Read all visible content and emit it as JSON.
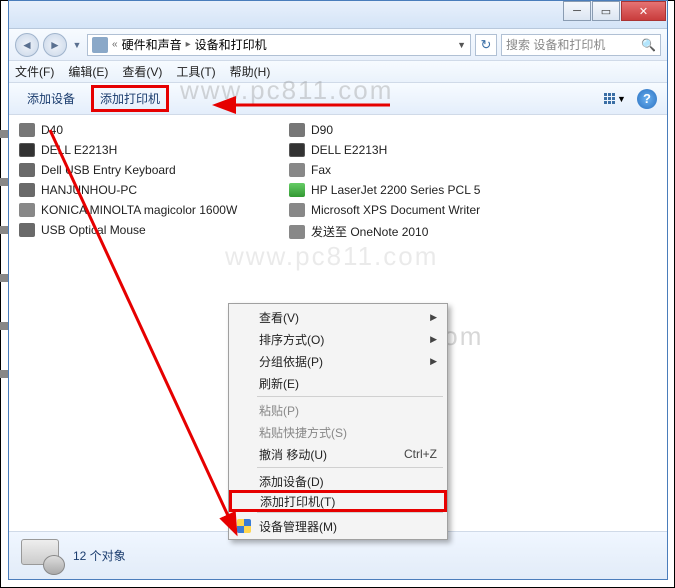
{
  "window": {
    "breadcrumb": {
      "seg1": "硬件和声音",
      "seg2": "设备和打印机"
    },
    "search_placeholder": "搜索 设备和打印机"
  },
  "menu": {
    "file": "文件(F)",
    "edit": "编辑(E)",
    "view": "查看(V)",
    "tools": "工具(T)",
    "help": "帮助(H)"
  },
  "toolbar": {
    "add_device": "添加设备",
    "add_printer": "添加打印机"
  },
  "devices_left": [
    "D40",
    "DELL E2213H",
    "Dell USB Entry Keyboard",
    "HANJUNHOU-PC",
    "KONICA MINOLTA magicolor 1600W",
    "USB Optical Mouse"
  ],
  "devices_right": [
    "D90",
    "DELL E2213H",
    "Fax",
    "HP LaserJet 2200 Series PCL 5",
    "Microsoft XPS Document Writer",
    "发送至 OneNote 2010"
  ],
  "context_menu": {
    "view": "查看(V)",
    "sort": "排序方式(O)",
    "group": "分组依据(P)",
    "refresh": "刷新(E)",
    "paste": "粘贴(P)",
    "paste_shortcut": "粘贴快捷方式(S)",
    "undo_move": "撤消 移动(U)",
    "undo_key": "Ctrl+Z",
    "add_device": "添加设备(D)",
    "add_printer": "添加打印机(T)",
    "device_manager": "设备管理器(M)"
  },
  "status": {
    "count": "12 个对象"
  },
  "watermark": "www.pc811.com"
}
